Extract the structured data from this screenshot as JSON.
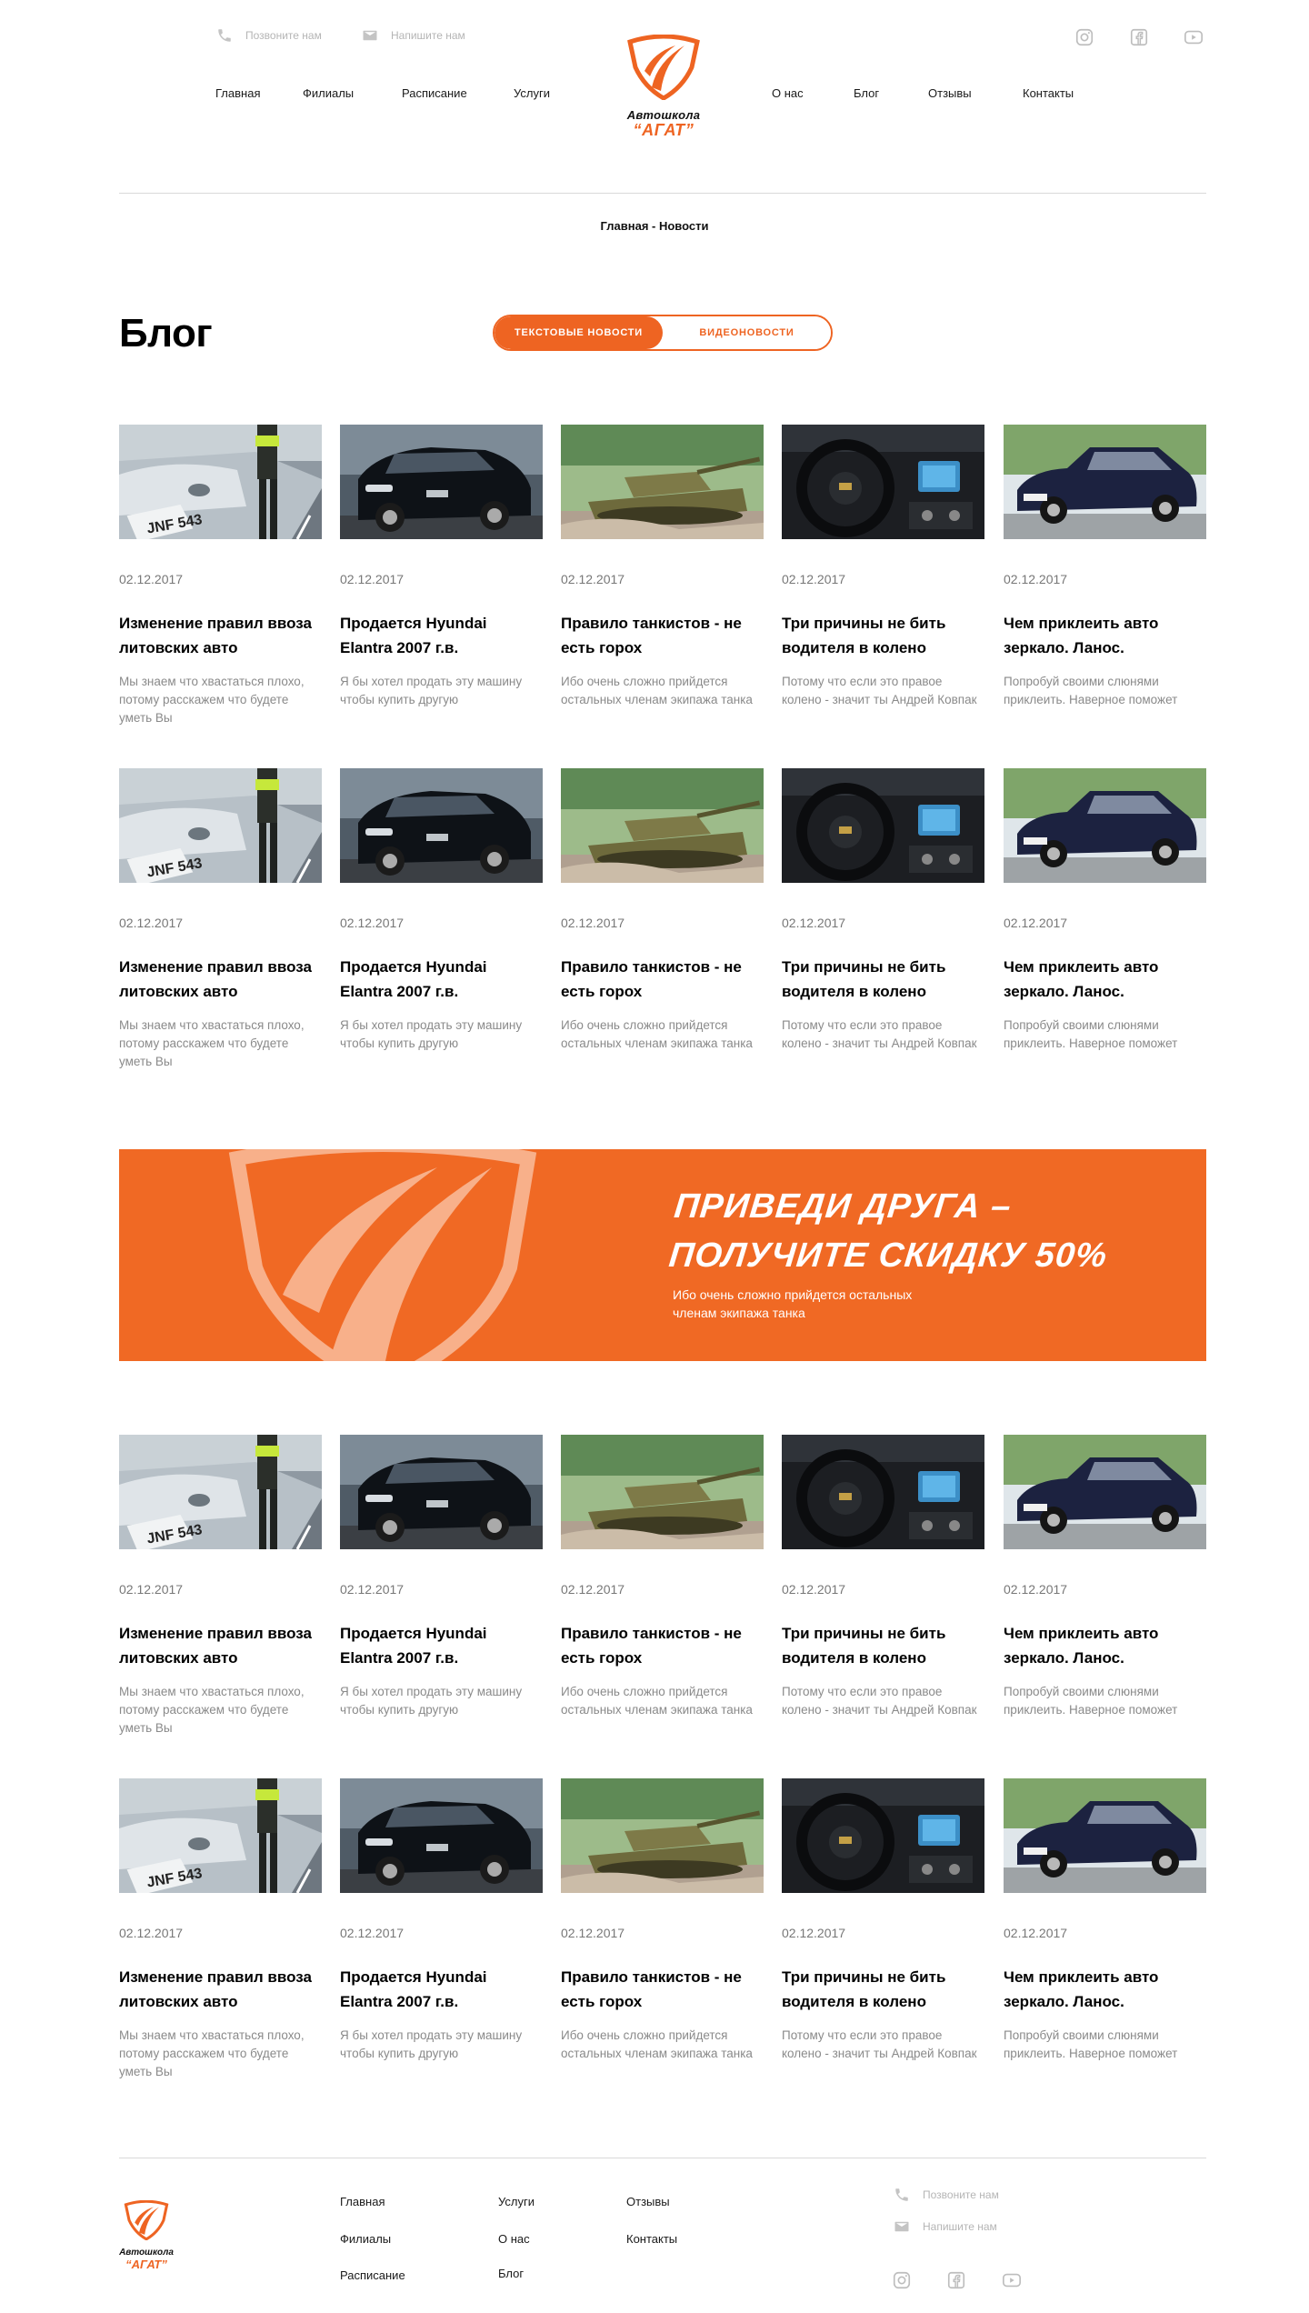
{
  "header": {
    "phone_label": "Позвоните нам",
    "mail_label": "Напишите нам",
    "nav_left": [
      "Главная",
      "Филиалы",
      "Расписание",
      "Услуги"
    ],
    "nav_right": [
      "О нас",
      "Блог",
      "Отзывы",
      "Контакты"
    ],
    "logo_line1": "Автошкола",
    "logo_line2": "“АГАТ”",
    "social": [
      "instagram-icon",
      "facebook-icon",
      "youtube-icon"
    ]
  },
  "breadcrumb": "Главная - Новости",
  "page_title": "Блог",
  "tabs": [
    {
      "label": "Текстовые новости",
      "active": true
    },
    {
      "label": "Видеоновости",
      "active": false
    }
  ],
  "cards": [
    {
      "image": "opel-police-photo",
      "date": "02.12.2017",
      "title": "Изменение правил ввоза литовских авто",
      "excerpt": "Мы знаем что хвастаться плохо, потому расскажем что будете уметь Вы"
    },
    {
      "image": "hyundai-elantra-photo",
      "date": "02.12.2017",
      "title": "Продается Hyundai Elantra 2007 г.в.",
      "excerpt": "Я бы хотел продать эту машину чтобы купить другую"
    },
    {
      "image": "tank-photo",
      "date": "02.12.2017",
      "title": "Правило танкистов - не есть горох",
      "excerpt": "Ибо очень сложно прийдется остальных членам экипажа танка"
    },
    {
      "image": "car-interior-photo",
      "date": "02.12.2017",
      "title": "Три причины не бить водителя в колено",
      "excerpt": "Потому что если это правое колено - значит ты Андрей Ковпак"
    },
    {
      "image": "lanos-photo",
      "date": "02.12.2017",
      "title": "Чем приклеить авто зеркало. Ланос.",
      "excerpt": "Попробуй своими слюнями приклеить. Наверное поможет"
    }
  ],
  "promo": {
    "line1": "ПРИВЕДИ ДРУГА –",
    "line2": "ПОЛУЧИТЕ СКИДКУ 50%",
    "text": "Ибо очень сложно прийдется остальных членам экипажа танка"
  },
  "footer": {
    "logo_line1": "Автошкола",
    "logo_line2": "“АГАТ”",
    "col1": [
      "Главная",
      "Филиалы",
      "Расписание"
    ],
    "col2": [
      "Услуги",
      "О нас",
      "Блог"
    ],
    "col3": [
      "Отзывы",
      "Контакты"
    ],
    "phone_label": "Позвоните нам",
    "mail_label": "Напишите нам"
  },
  "colors": {
    "accent": "#ee6422",
    "promo_bg": "#f06924"
  }
}
